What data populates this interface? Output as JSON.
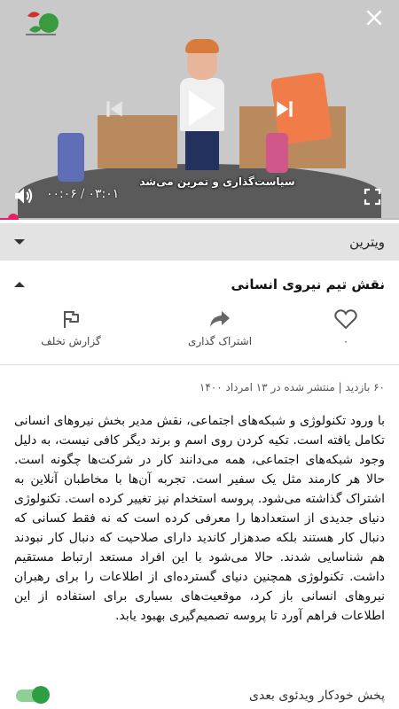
{
  "player": {
    "subtitle": "سیاست‌گذاری و تمرین می‌شد",
    "current_time": "۰۰:۰۶",
    "separator": "/",
    "duration": "۰۳:۰۱",
    "progress_fraction": 0.033,
    "icons": {
      "close": "close-icon",
      "previous": "skip-previous-icon",
      "play": "play-icon",
      "next": "skip-next-icon",
      "volume": "volume-icon",
      "fullscreen": "fullscreen-icon"
    }
  },
  "category": {
    "label": "ویترین"
  },
  "video": {
    "title": "نقش تیم نیروی انسانی"
  },
  "actions": {
    "like_count": "۰",
    "share_label": "اشتراک گذاری",
    "report_label": "گزارش تخلف"
  },
  "meta": {
    "text": "۶۰ بازدید | منتشر شده در ۱۳ امرداد ۱۴۰۰"
  },
  "description": "با ورود تکنولوژی و شبکه‌های اجتماعی، نقش مدیر بخش نیروهای انسانی تکامل یافته است. تکیه کردن روی اسم و برند دیگر کافی نیست، به دلیل وجود شبکه‌های اجتماعی، همه می‌دانند کار در شرکت‌ها چگونه است. حالا هر کارمند مثل یک سفیر است. تجربه آن‌ها با مخاطبان آنلاین به اشتراک گذاشته می‌شود. پروسه استخدام نیز تغییر کرده است. تکنولوژی دنیای جدیدی از استعدادها را معرفی کرده است که نه فقط کسانی که دنبال کار هستند بلکه صدهزار کاندید دارای صلاحیت که دنبال کار نبودند هم شناسایی شدند. حالا می‌شود با این افراد مستعد ارتباط مستقیم داشت. تکنولوژی همچنین دنیای گسترده‌ای از اطلاعات را برای رهبران نیروهای انسانی باز کرد، موقعیت‌های بسیاری برای استفاده از این اطلاعات فراهم آورد تا پروسه تصمیم‌گیری بهبود یابد.",
  "autoplay": {
    "label": "پخش خودکار ویدئوی بعدی",
    "enabled": true
  },
  "colors": {
    "accent": "#e91e63",
    "toggle_on": "#2e9e44"
  }
}
